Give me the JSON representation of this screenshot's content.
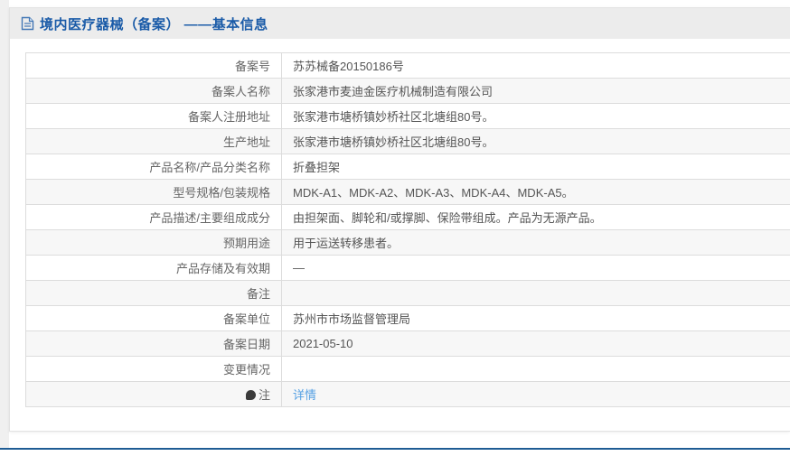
{
  "page": {
    "title": "境内医疗器械（备案） ——基本信息",
    "title_icon": "document-icon"
  },
  "colors": {
    "title_blue": "#1a5ba8",
    "link_blue": "#55a0e3",
    "footer_blue": "#1e5c94",
    "row_stripe": "#f7f7f7"
  },
  "table": {
    "rows": [
      {
        "label": "备案号",
        "value": "苏苏械备20150186号"
      },
      {
        "label": "备案人名称",
        "value": "张家港市麦迪金医疗机械制造有限公司"
      },
      {
        "label": "备案人注册地址",
        "value": "张家港市塘桥镇妙桥社区北塘组80号。"
      },
      {
        "label": "生产地址",
        "value": "张家港市塘桥镇妙桥社区北塘组80号。"
      },
      {
        "label": "产品名称/产品分类名称",
        "value": "折叠担架"
      },
      {
        "label": "型号规格/包装规格",
        "value": "MDK-A1、MDK-A2、MDK-A3、MDK-A4、MDK-A5。"
      },
      {
        "label": "产品描述/主要组成成分",
        "value": "由担架面、脚轮和/或撑脚、保险带组成。产品为无源产品。"
      },
      {
        "label": "预期用途",
        "value": "用于运送转移患者。"
      },
      {
        "label": "产品存储及有效期",
        "value": "—"
      },
      {
        "label": "备注",
        "value": ""
      },
      {
        "label": "备案单位",
        "value": "苏州市市场监督管理局"
      },
      {
        "label": "备案日期",
        "value": "2021-05-10"
      },
      {
        "label": "变更情况",
        "value": ""
      },
      {
        "label": "注",
        "value": "详情",
        "label_icon": "note-icon",
        "link": true
      }
    ]
  }
}
